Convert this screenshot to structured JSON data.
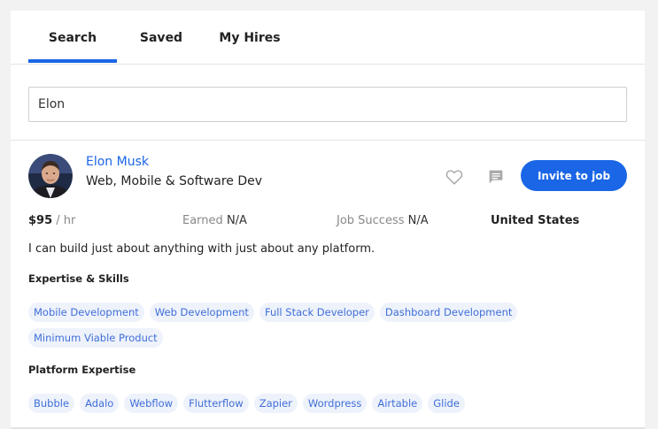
{
  "tabs": [
    {
      "label": "Search"
    },
    {
      "label": "Saved"
    },
    {
      "label": "My Hires"
    }
  ],
  "search": {
    "value": "Elon"
  },
  "profile": {
    "name": "Elon Musk",
    "title": "Web, Mobile & Software Dev",
    "invite_label": "Invite to job",
    "rate_amount": "$95",
    "rate_unit": "/ hr",
    "earned_label": "Earned",
    "earned_value": "N/A",
    "success_label": "Job Success",
    "success_value": "N/A",
    "country": "United States",
    "description": "I can build just about anything with just about any platform.",
    "skills_title": "Expertise & Skills",
    "skills": [
      "Mobile Development",
      "Web Development",
      "Full Stack Developer",
      "Dashboard Development",
      "Minimum Viable Product"
    ],
    "platform_title": "Platform Expertise",
    "platforms": [
      "Bubble",
      "Adalo",
      "Webflow",
      "Flutterflow",
      "Zapier",
      "Wordpress",
      "Airtable",
      "Glide"
    ]
  },
  "icons": {
    "favorite": "heart-icon",
    "message": "message-icon"
  },
  "colors": {
    "accent": "#1a66e6",
    "tag_bg": "#eef2fb",
    "tag_text": "#3f6fd8"
  }
}
